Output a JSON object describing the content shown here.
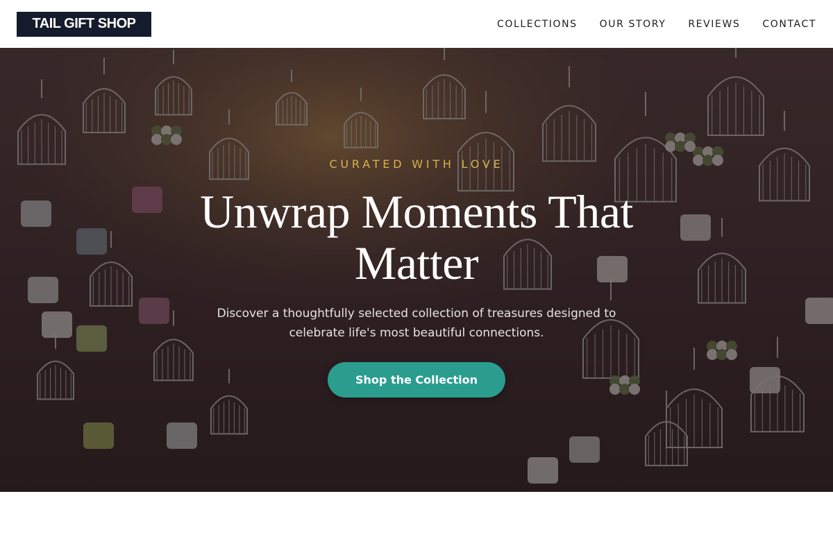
{
  "header": {
    "logo": "TAIL GIFT SHOP",
    "nav": [
      "COLLECTIONS",
      "OUR STORY",
      "REVIEWS",
      "CONTACT"
    ]
  },
  "hero": {
    "eyebrow": "CURATED WITH LOVE",
    "headline": "Unwrap Moments That Matter",
    "subtext": "Discover a thoughtfully selected collection of treasures designed to celebrate life's most beautiful connections.",
    "cta": "Shop the Collection",
    "background_description_icon": "gift-shop-hanging-birdcages-photo"
  },
  "colors": {
    "logo_bg": "#141b2d",
    "accent_gold": "#d8b34f",
    "cta_teal": "#2a9d8f",
    "overlay": "#281a1e"
  }
}
